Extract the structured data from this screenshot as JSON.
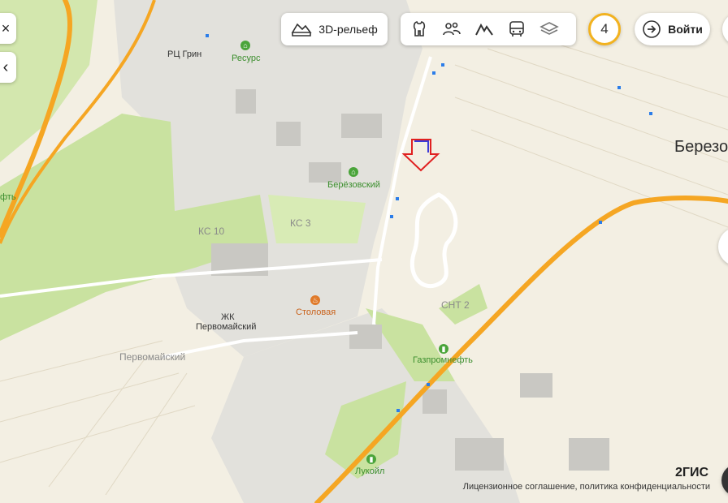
{
  "map": {
    "labels": {
      "rc_grin": "РЦ Грин",
      "resurs": "Ресурс",
      "berezovsky": "Берёзовский",
      "ks10": "КС 10",
      "ks3": "КС 3",
      "stolovaya": "Столовая",
      "zhk": "ЖК",
      "pervomaysky_zhk": "Первомайский",
      "pervomaysky": "Первомайский",
      "snt2": "СНТ 2",
      "gazpromneft": "Газпромнефть",
      "lukoil": "Лукойл",
      "city_partial": "Березо",
      "left_partial": "фть"
    }
  },
  "controls": {
    "close_symbol": "×",
    "collapse_symbol": "‹",
    "relief_label": "3D-рельеф",
    "badge_count": "4",
    "login_label": "Войти"
  },
  "footer": {
    "logo": "2ГИС",
    "legal": "Лицензионное соглашение, политика конфиденциальности"
  },
  "colors": {
    "road_major": "#f5a623",
    "green": "#cfe5a8",
    "industrial": "#dcdcdc",
    "marker": "#e02020",
    "badge_ring": "#f2b21f"
  }
}
